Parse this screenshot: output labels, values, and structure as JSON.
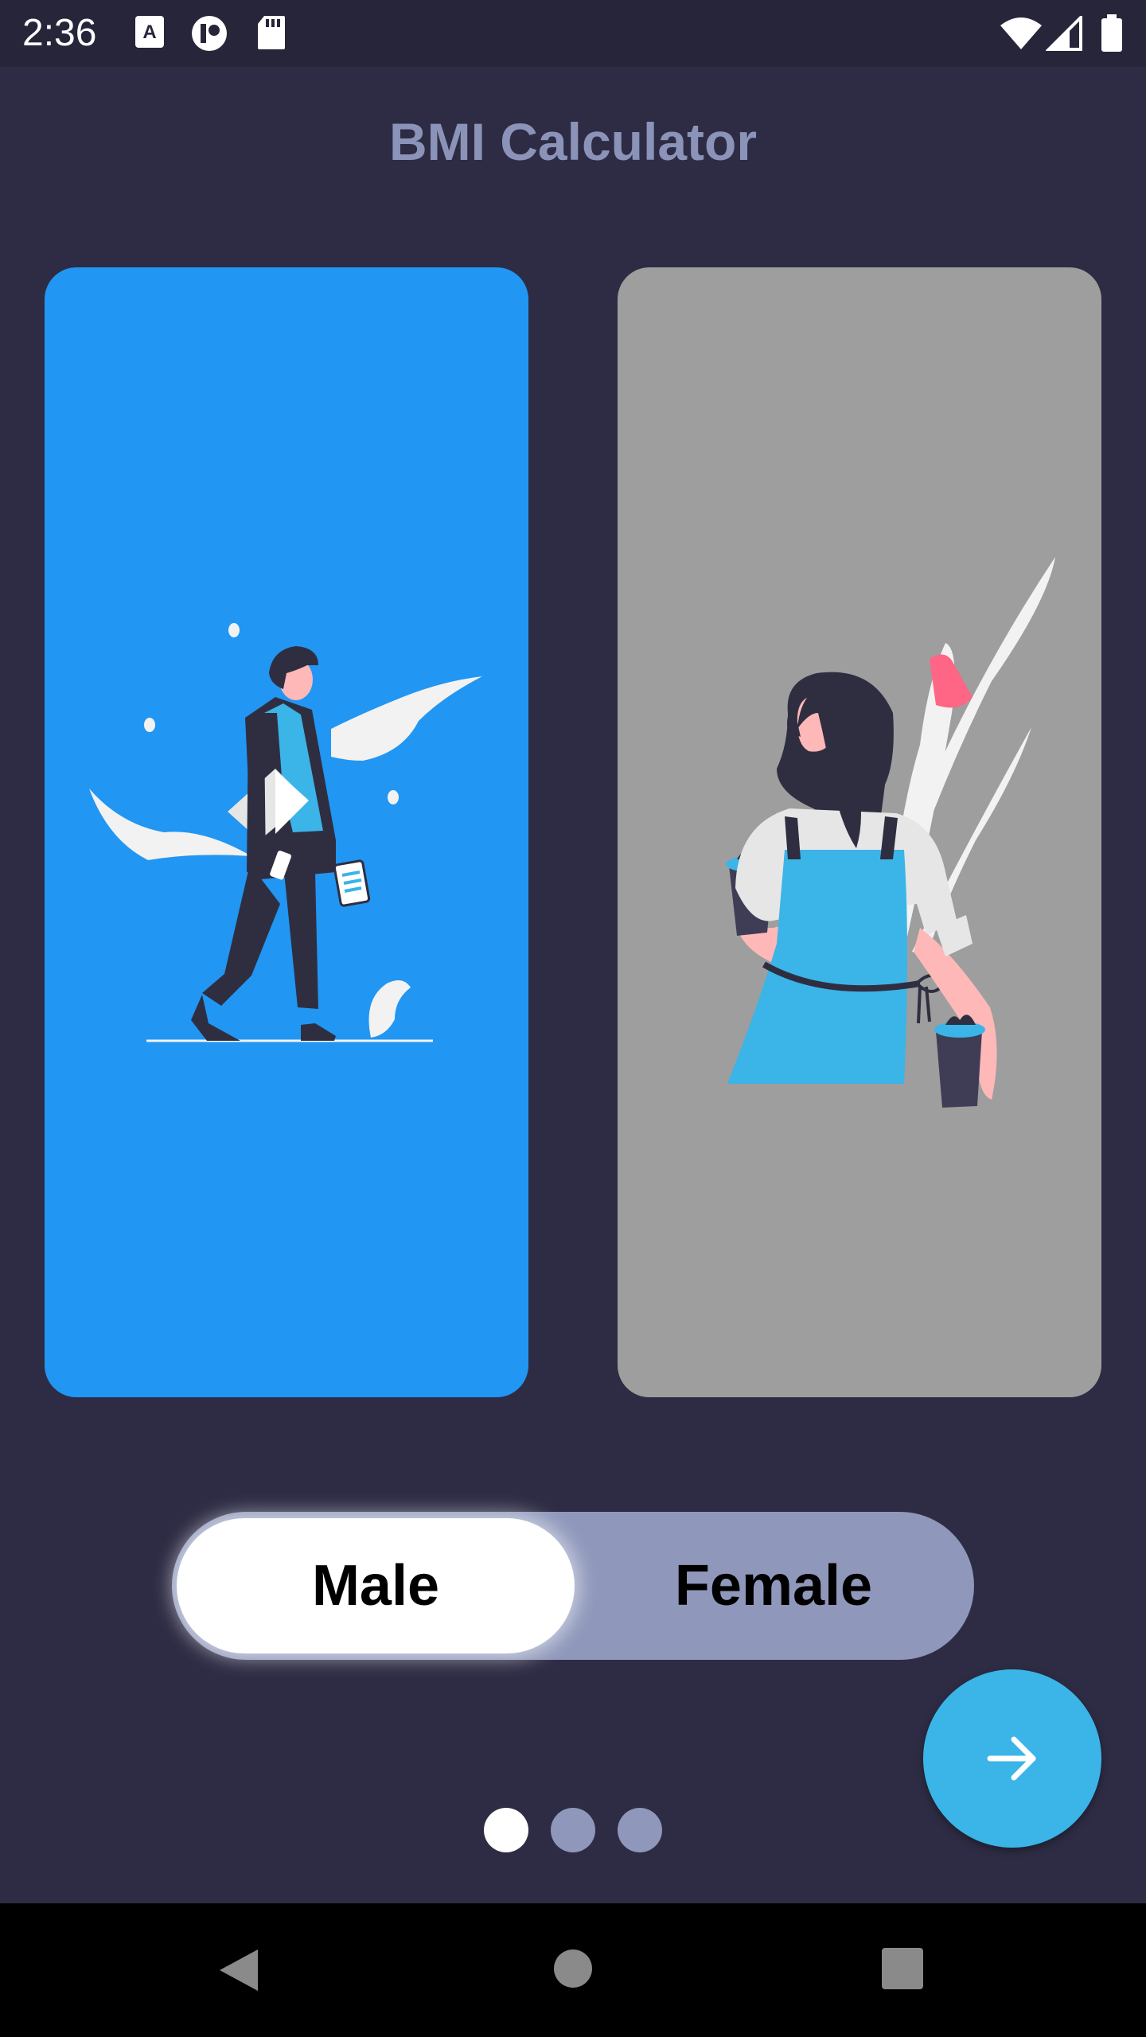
{
  "status_bar": {
    "time": "2:36",
    "left_icons": [
      "a-text-icon",
      "circle-app-icon",
      "sd-card-icon"
    ],
    "right_icons": [
      "wifi-icon",
      "signal-icon",
      "battery-icon"
    ]
  },
  "app": {
    "title": "BMI Calculator"
  },
  "cards": {
    "male": {
      "color": "#2196f3",
      "illustration": "man-walking-illustration"
    },
    "female": {
      "color": "#9e9e9e",
      "illustration": "woman-barista-illustration"
    }
  },
  "gender_toggle": {
    "options": [
      "Male",
      "Female"
    ],
    "male_label": "Male",
    "female_label": "Female",
    "selected": "Male"
  },
  "next_button": {
    "icon": "arrow-right-icon",
    "color": "#3bb4e8"
  },
  "pagination": {
    "total": 3,
    "current": 1
  },
  "nav_bar": {
    "icons": [
      "back-icon",
      "home-icon",
      "recents-icon"
    ]
  },
  "colors": {
    "background": "#2d2c44",
    "accent": "#3bb4e8",
    "muted": "#8f98bb"
  }
}
